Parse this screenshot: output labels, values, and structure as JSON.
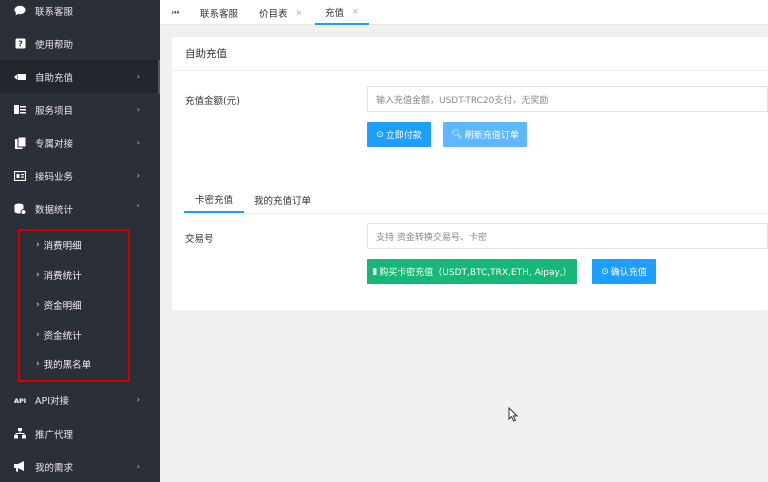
{
  "sidebar": {
    "items": [
      {
        "label": "联系客服",
        "icon": "chat-icon",
        "arrow": false
      },
      {
        "label": "使用帮助",
        "icon": "help-icon",
        "arrow": false
      },
      {
        "label": "自助充值",
        "icon": "recharge-icon",
        "arrow": true
      },
      {
        "label": "服务项目",
        "icon": "services-icon",
        "arrow": true
      },
      {
        "label": "专属对接",
        "icon": "docs-icon",
        "arrow": true
      },
      {
        "label": "接码业务",
        "icon": "sms-icon",
        "arrow": true
      },
      {
        "label": "数据统计",
        "icon": "database-icon",
        "arrow": true
      }
    ],
    "sub_items": [
      "消费明细",
      "消费统计",
      "资金明细",
      "资金统计",
      "我的黑名单"
    ],
    "bottom_items": [
      {
        "label": "API对接",
        "icon": "api-icon",
        "arrow": true
      },
      {
        "label": "推广代理",
        "icon": "sitemap-icon",
        "arrow": false
      },
      {
        "label": "我的需求",
        "icon": "megaphone-icon",
        "arrow": true
      }
    ]
  },
  "tabs": {
    "nav_icon": "⏮",
    "items": [
      "联系客服",
      "价目表",
      "充值"
    ]
  },
  "panel": {
    "title": "自助充值",
    "amount_label": "充值金额(元)",
    "amount_placeholder": "输入充值金额，USDT-TRC20支付，无奖励",
    "pay_button": "立即付款",
    "refresh_button": "刷新充值订单",
    "subtabs": [
      "卡密充值",
      "我的充值订单"
    ],
    "txn_label": "交易号",
    "txn_placeholder": "支持 资金转换交易号、卡密",
    "buy_card_button": "购买卡密充值（USDT,BTC,TRX,ETH, Aipay,）",
    "confirm_button": "确认充值"
  },
  "colors": {
    "sidebar_bg": "#2b2f37",
    "primary_blue": "#1e9fff",
    "light_blue": "#5fb8ff",
    "green": "#16b777",
    "highlight_red": "#d40000"
  }
}
